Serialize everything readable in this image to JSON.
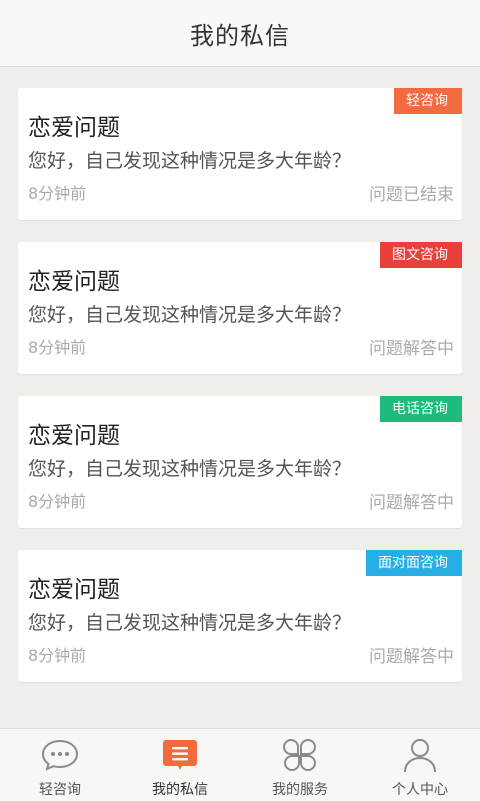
{
  "header": {
    "title": "我的私信"
  },
  "messages": [
    {
      "badge": "轻咨询",
      "badge_color": "#f26a3d",
      "title": "恋爱问题",
      "question": "您好，自己发现这种情况是多大年龄？",
      "time": "8分钟前",
      "status": "问题已结束"
    },
    {
      "badge": "图文咨询",
      "badge_color": "#e8413c",
      "title": "恋爱问题",
      "question": "您好，自己发现这种情况是多大年龄？",
      "time": "8分钟前",
      "status": "问题解答中"
    },
    {
      "badge": "电话咨询",
      "badge_color": "#1dbc7c",
      "title": "恋爱问题",
      "question": "您好，自己发现这种情况是多大年龄？",
      "time": "8分钟前",
      "status": "问题解答中"
    },
    {
      "badge": "面对面咨询",
      "badge_color": "#27aee4",
      "title": "恋爱问题",
      "question": "您好，自己发现这种情况是多大年龄？",
      "time": "8分钟前",
      "status": "问题解答中"
    }
  ],
  "tabs": [
    {
      "label": "轻咨询",
      "icon": "chat-bubble-icon"
    },
    {
      "label": "我的私信",
      "icon": "message-list-icon",
      "active": true
    },
    {
      "label": "我的服务",
      "icon": "clover-grid-icon"
    },
    {
      "label": "个人中心",
      "icon": "person-icon"
    }
  ],
  "colors": {
    "accent": "#f26a3d",
    "background": "#efeeea"
  }
}
